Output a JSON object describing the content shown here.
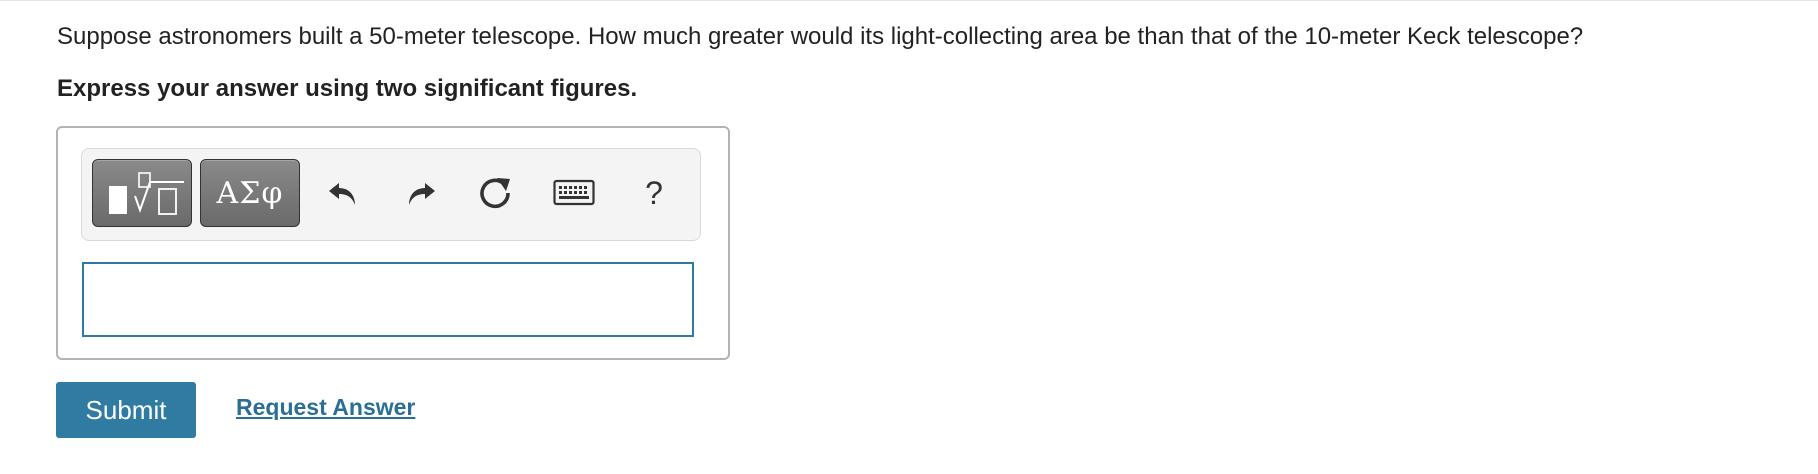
{
  "question": {
    "text": "Suppose astronomers built a 50-meter telescope. How much greater would its light-collecting area be than that of the 10-meter Keck telescope?",
    "instruction": "Express your answer using two significant figures."
  },
  "toolbar": {
    "templates_icon": "templates-radical-icon",
    "greek_label": "ΑΣφ",
    "undo_icon": "undo-icon",
    "redo_icon": "redo-icon",
    "reset_icon": "reset-icon",
    "keyboard_icon": "keyboard-icon",
    "help_label": "?"
  },
  "answer": {
    "value": "",
    "placeholder": ""
  },
  "actions": {
    "submit_label": "Submit",
    "request_answer_label": "Request Answer"
  },
  "colors": {
    "primary": "#2f7ba2",
    "link": "#2a6f96",
    "input_border": "#2e7aa0"
  }
}
